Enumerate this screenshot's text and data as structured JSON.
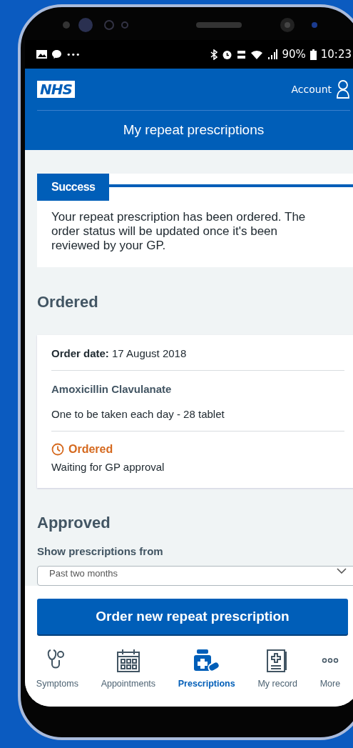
{
  "status_bar": {
    "notifications_more": "•••",
    "battery_percent": "90%",
    "time": "10:23"
  },
  "header": {
    "logo": "NHS",
    "account": "Account",
    "title": "My repeat prescriptions"
  },
  "success": {
    "label": "Success",
    "message": "Your repeat prescription has been ordered. The order status will be updated once it's been reviewed by your GP."
  },
  "ordered": {
    "heading": "Ordered",
    "order": {
      "date_line": "**Order date:** 17 August 2018",
      "medicine": "Amoxicillin Clavulanate",
      "dosage": "One to be taken each day - 28 tablet",
      "status": {
        "label": "Ordered",
        "color": "#d5691e"
      },
      "status_note": "Waiting for GP approval"
    }
  },
  "approved": {
    "heading": "Approved",
    "filter_label": "Show prescriptions from",
    "filter_value": "Past two months"
  },
  "order_button": "Order new repeat prescription",
  "nav": [
    {
      "kind": "symptoms",
      "label": "Symptoms",
      "selected": false
    },
    {
      "kind": "appointments",
      "label": "Appointments",
      "selected": false
    },
    {
      "kind": "prescriptions",
      "label": "Prescriptions",
      "selected": true
    },
    {
      "kind": "record",
      "label": "My record",
      "selected": false
    },
    {
      "kind": "more",
      "label": "More",
      "selected": false
    }
  ]
}
